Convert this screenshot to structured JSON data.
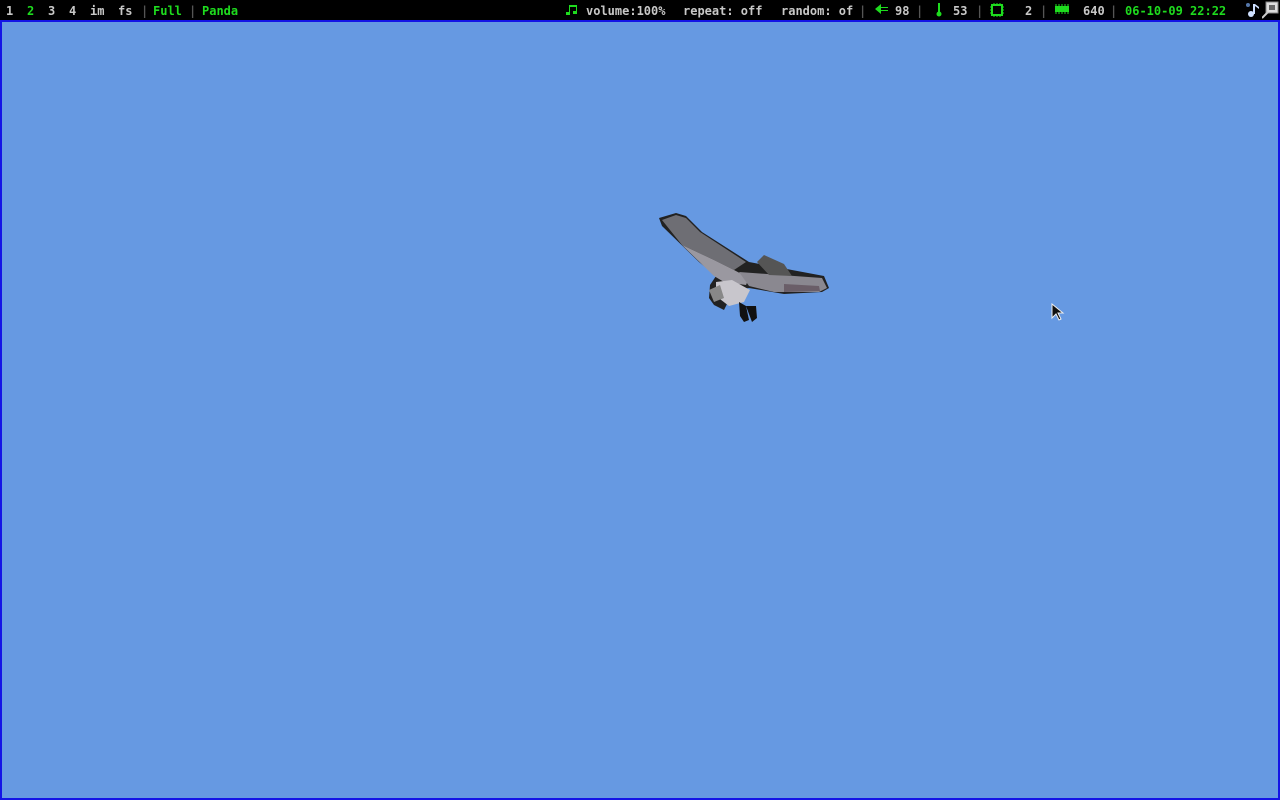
{
  "statusbar": {
    "workspaces": [
      "1",
      "2",
      "3",
      "4",
      "im",
      "fs"
    ],
    "active_workspace": "2",
    "layout": "Full",
    "window_title": "Panda",
    "volume": "volume:100%",
    "repeat": "repeat: off",
    "random": "random: of",
    "battery": "98",
    "temperature": "53",
    "cpu": "2",
    "memory": "640",
    "datetime": "06-10-09 22:22",
    "separator": "|"
  },
  "colors": {
    "accent": "#1edc1e",
    "background": "#6699e2",
    "border": "#1414e6"
  },
  "icons": [
    "music-note-icon",
    "power-plug-icon",
    "thermometer-icon",
    "cpu-chip-icon",
    "memory-icon",
    "tray-music-icon",
    "tray-window-icon",
    "mouse-cursor-icon"
  ]
}
